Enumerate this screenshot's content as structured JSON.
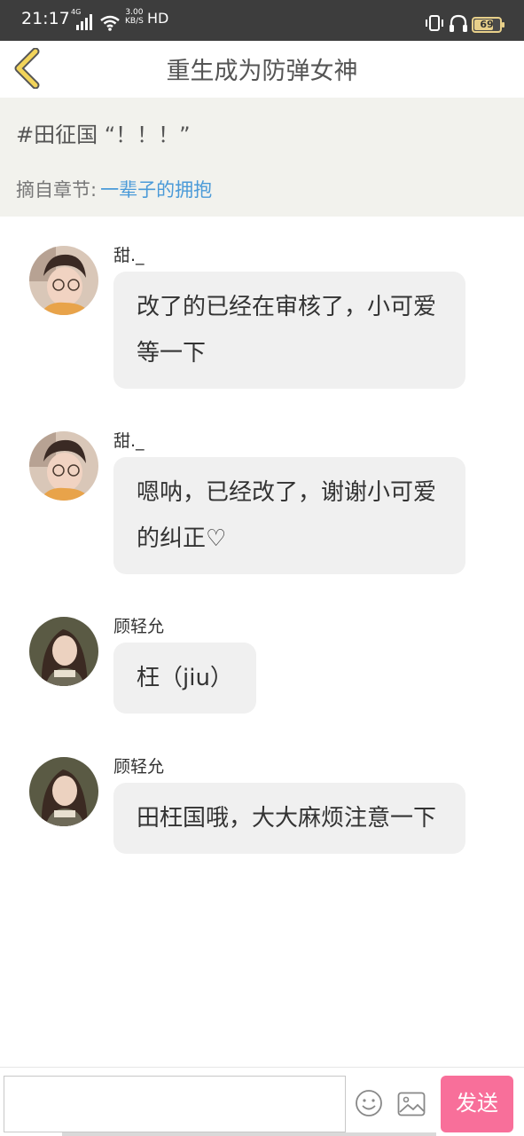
{
  "status_bar": {
    "time": "21:17",
    "network": "4G",
    "speed_value": "3.00",
    "speed_unit": "KB/S",
    "hd": "HD",
    "battery": "69",
    "battery_level": 0.69
  },
  "header": {
    "title": "重生成为防弹女神",
    "back_icon": "chevron-left-icon"
  },
  "banner": {
    "topic": "#田征国 “！！！”",
    "chapter_label": "摘自章节:",
    "chapter_link": "一辈子的拥抱"
  },
  "messages": [
    {
      "name": "甜._",
      "text": "改了的已经在审核了，小可爱等一下"
    },
    {
      "name": "甜._",
      "text": "嗯呐，已经改了，谢谢小可爱的纠正♡"
    },
    {
      "name": "顾轻允",
      "text": "枉（jiu）"
    },
    {
      "name": "顾轻允",
      "text": "田枉国哦，大大麻烦注意一下"
    }
  ],
  "input_bar": {
    "placeholder": "",
    "send_label": "发送",
    "emoji_icon": "emoji-icon",
    "image_icon": "image-icon"
  },
  "colors": {
    "status_bar_bg": "#3d3d3d",
    "banner_bg": "#f2f2ed",
    "link": "#4a9ad8",
    "send_button": "#f86f9a",
    "back_chevron": "#f2d45a"
  }
}
